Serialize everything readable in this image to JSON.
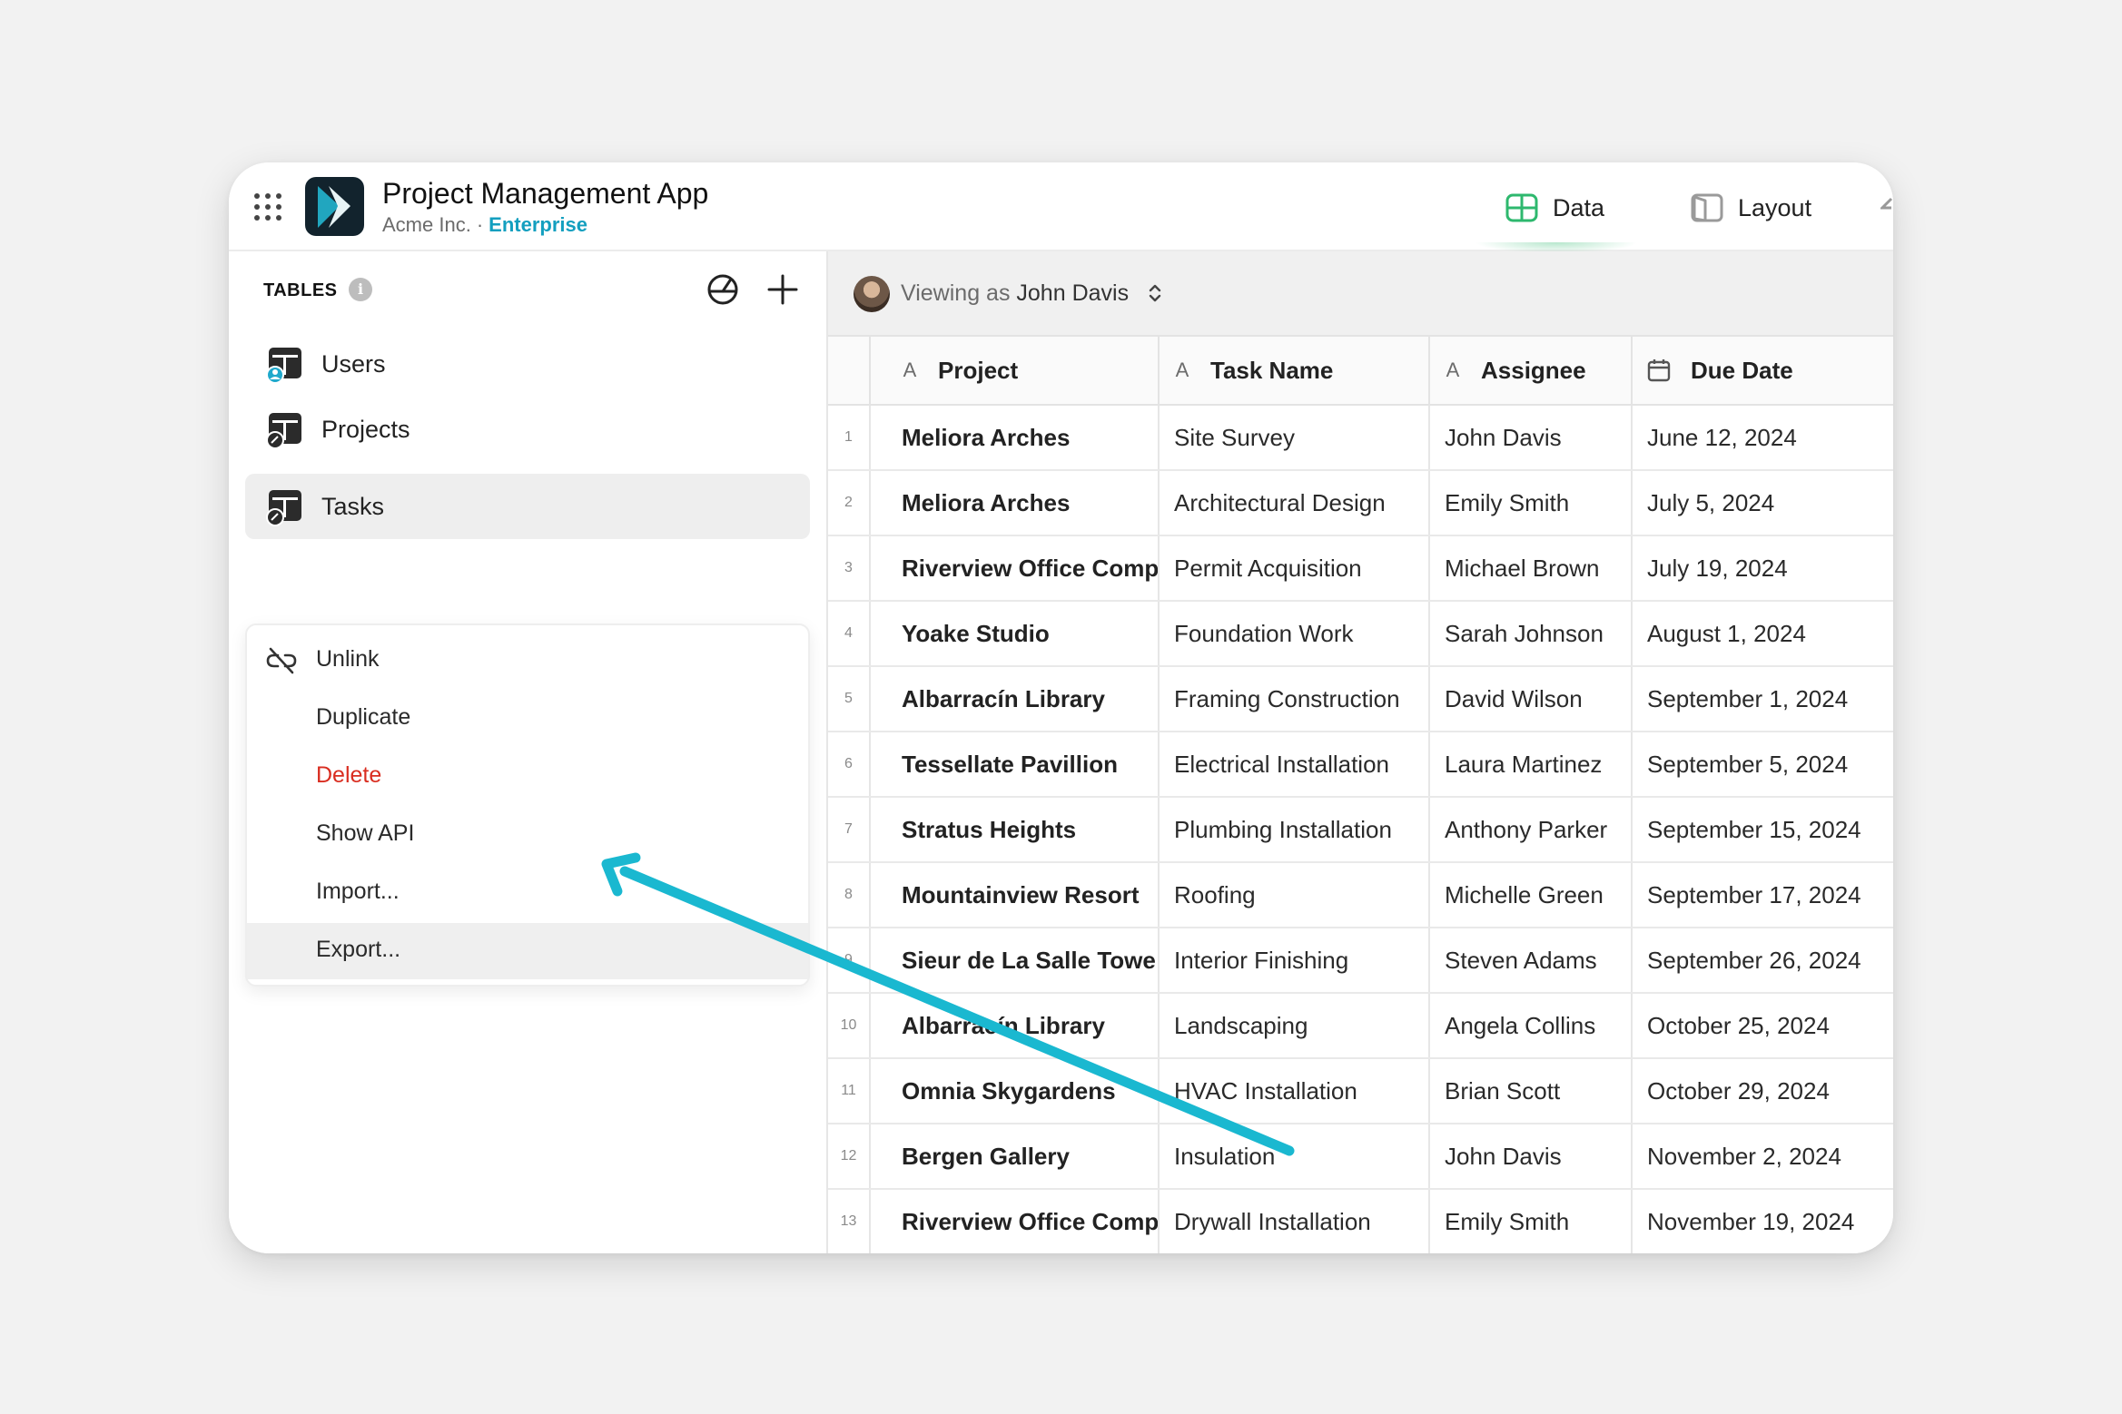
{
  "app": {
    "title": "Project Management App",
    "org": "Acme Inc.",
    "separator": "·",
    "plan": "Enterprise"
  },
  "view_tabs": [
    {
      "label": "Data",
      "icon": "table-icon",
      "active": true
    },
    {
      "label": "Layout",
      "icon": "layout-icon",
      "active": false
    }
  ],
  "sidebar": {
    "section_label": "TABLES",
    "info_glyph": "i",
    "items": [
      {
        "label": "Users",
        "icon": "users-table-icon",
        "active": false
      },
      {
        "label": "Projects",
        "icon": "projects-table-icon",
        "active": false
      },
      {
        "label": "Tasks",
        "icon": "tasks-table-icon",
        "active": true
      }
    ]
  },
  "context_menu": {
    "items": [
      {
        "label": "Unlink",
        "icon": "unlink-icon"
      },
      {
        "label": "Duplicate"
      },
      {
        "label": "Delete",
        "danger": true
      },
      {
        "label": "Show API"
      },
      {
        "label": "Import..."
      },
      {
        "label": "Export...",
        "hovered": true
      }
    ]
  },
  "viewing_bar": {
    "prefix": "Viewing as",
    "user": "John Davis"
  },
  "table": {
    "columns": [
      {
        "label": "Project",
        "type_icon": "A"
      },
      {
        "label": "Task Name",
        "type_icon": "A"
      },
      {
        "label": "Assignee",
        "type_icon": "A"
      },
      {
        "label": "Due Date",
        "type_icon": "calendar-icon"
      }
    ],
    "rows": [
      [
        "1",
        "Meliora Arches",
        "Site Survey",
        "John Davis",
        "June 12, 2024"
      ],
      [
        "2",
        "Meliora Arches",
        "Architectural Design",
        "Emily Smith",
        "July 5, 2024"
      ],
      [
        "3",
        "Riverview Office Comp",
        "Permit Acquisition",
        "Michael Brown",
        "July 19, 2024"
      ],
      [
        "4",
        "Yoake Studio",
        "Foundation Work",
        "Sarah Johnson",
        "August 1, 2024"
      ],
      [
        "5",
        "Albarracín Library",
        "Framing Construction",
        "David Wilson",
        "September 1, 2024"
      ],
      [
        "6",
        "Tessellate Pavillion",
        "Electrical Installation",
        "Laura Martinez",
        "September 5, 2024"
      ],
      [
        "7",
        "Stratus Heights",
        "Plumbing Installation",
        "Anthony Parker",
        "September 15, 2024"
      ],
      [
        "8",
        "Mountainview Resort",
        "Roofing",
        "Michelle Green",
        "September 17, 2024"
      ],
      [
        "9",
        "Sieur de La Salle Towe",
        "Interior Finishing",
        "Steven Adams",
        "September 26, 2024"
      ],
      [
        "10",
        "Albarracín Library",
        "Landscaping",
        "Angela Collins",
        "October 25, 2024"
      ],
      [
        "11",
        "Omnia Skygardens",
        "HVAC Installation",
        "Brian Scott",
        "October 29, 2024"
      ],
      [
        "12",
        "Bergen Gallery",
        "Insulation",
        "John Davis",
        "November 2, 2024"
      ],
      [
        "13",
        "Riverview Office Comp",
        "Drywall Installation",
        "Emily Smith",
        "November 19, 2024"
      ]
    ]
  },
  "colors": {
    "accent": "#139fbf",
    "data_tab_green": "#2eb86e",
    "danger": "#d92d20",
    "arrow": "#1ab8d0"
  }
}
